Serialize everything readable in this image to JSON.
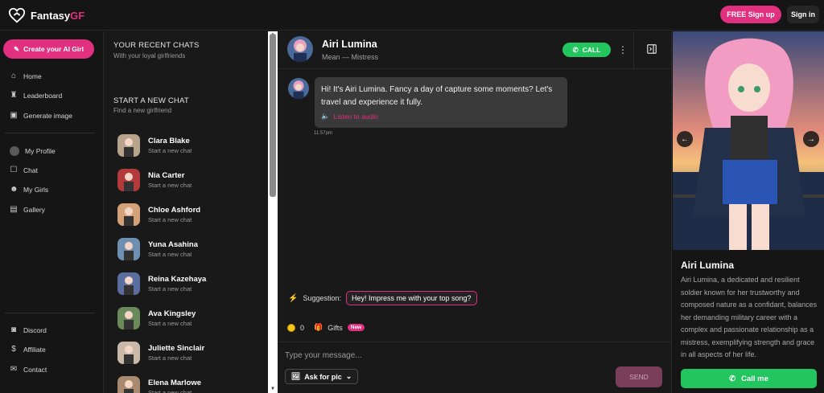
{
  "topbar": {
    "logo_prefix": "Fantasy",
    "logo_suffix": "GF",
    "signup_label": "FREE Sign up",
    "signin_label": "Sign in"
  },
  "sidebar": {
    "create_label": "Create your AI Girl",
    "nav": [
      {
        "label": "Home",
        "icon": "home-icon"
      },
      {
        "label": "Leaderboard",
        "icon": "trophy-icon"
      },
      {
        "label": "Generate image",
        "icon": "image-icon"
      }
    ],
    "account": [
      {
        "label": "My Profile",
        "icon": "avatar-icon"
      },
      {
        "label": "Chat",
        "icon": "chat-icon"
      },
      {
        "label": "My Girls",
        "icon": "girls-icon"
      },
      {
        "label": "Gallery",
        "icon": "gallery-icon"
      }
    ],
    "footer": [
      {
        "label": "Discord",
        "icon": "discord-icon"
      },
      {
        "label": "Affiliate",
        "icon": "dollar-icon"
      },
      {
        "label": "Contact",
        "icon": "mail-icon"
      }
    ]
  },
  "chatlist": {
    "recent_title": "YOUR RECENT CHATS",
    "recent_sub": "With your loyal girlfriends",
    "new_title": "START A NEW CHAT",
    "new_sub": "Find a new girlfriend",
    "entries": [
      {
        "name": "Clara Blake",
        "status": "Start a new chat",
        "color": "#b8a48a"
      },
      {
        "name": "Nia Carter",
        "status": "Start a new chat",
        "color": "#b23a3a"
      },
      {
        "name": "Chloe Ashford",
        "status": "Start a new chat",
        "color": "#d4a27a"
      },
      {
        "name": "Yuna Asahina",
        "status": "Start a new chat",
        "color": "#6f8fb0"
      },
      {
        "name": "Reina Kazehaya",
        "status": "Start a new chat",
        "color": "#5a6fa0"
      },
      {
        "name": "Ava Kingsley",
        "status": "Start a new chat",
        "color": "#6a8a5a"
      },
      {
        "name": "Juliette Sinclair",
        "status": "Start a new chat",
        "color": "#c9b9a8"
      },
      {
        "name": "Elena Marlowe",
        "status": "Start a new chat",
        "color": "#a88a70"
      }
    ]
  },
  "chat": {
    "name": "Airi Lumina",
    "subtitle": "Mean — Mistress",
    "call_label": "CALL",
    "message": "Hi! It's Airi Lumina. Fancy a day of capture some moments? Let's travel and experience it fully.",
    "listen_label": "Listen to audio",
    "time": "11:57pm",
    "suggestion_label": "Suggestion:",
    "suggestion_text": "Hey! Impress me with your top song?",
    "coins": "0",
    "gifts_label": "Gifts",
    "new_badge": "New",
    "input_placeholder": "Type your message...",
    "ask_pic_label": "Ask for pic",
    "send_label": "SEND"
  },
  "profile": {
    "name": "Airi Lumina",
    "description": "Airi Lumina, a dedicated and resilient soldier known for her trustworthy and composed nature as a confidant, balances her demanding military career with a complex and passionate relationship as a mistress, exemplifying strength and grace in all aspects of her life.",
    "call_label": "Call me"
  },
  "colors": {
    "accent_pink": "#e0307f",
    "call_green": "#22c55e",
    "background": "#151515"
  }
}
